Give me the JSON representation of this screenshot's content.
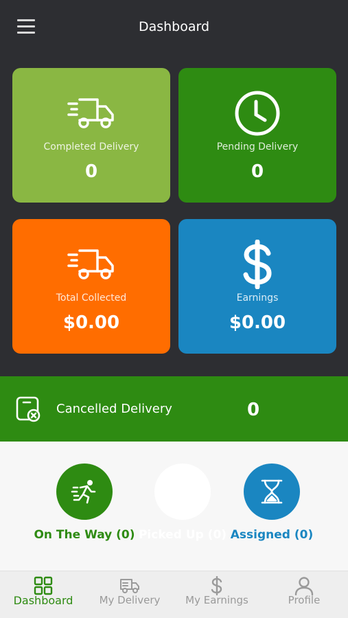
{
  "header": {
    "title": "Dashboard",
    "menu_icon": "hamburger-menu-icon"
  },
  "cards": [
    {
      "label": "Completed Delivery",
      "value": "0",
      "color": "#8ab743",
      "icon": "delivery-truck-icon"
    },
    {
      "label": "Pending Delivery",
      "value": "0",
      "color": "#2e8b12",
      "icon": "clock-icon"
    },
    {
      "label": "Total Collected",
      "value": "$0.00",
      "color": "#ff6d00",
      "icon": "delivery-truck-icon"
    },
    {
      "label": "Earnings",
      "value": "$0.00",
      "color": "#1a86c1",
      "icon": "dollar-icon"
    }
  ],
  "cancelled": {
    "label": "Cancelled Delivery",
    "value": "0",
    "color": "#2e8b12",
    "icon": "cancelled-package-icon"
  },
  "status": [
    {
      "label": "On The Way (0)",
      "color": "#2e8b12",
      "icon": "running-icon"
    },
    {
      "label": "Picked Up (0)",
      "color": "#ffffff",
      "icon": ""
    },
    {
      "label": "Assigned (0)",
      "color": "#1a86c1",
      "icon": "hourglass-icon"
    }
  ],
  "nav": [
    {
      "label": "Dashboard",
      "icon": "grid-icon",
      "active": true
    },
    {
      "label": "My Delivery",
      "icon": "delivery-truck-icon",
      "active": false
    },
    {
      "label": "My Earnings",
      "icon": "dollar-icon",
      "active": false
    },
    {
      "label": "Profile",
      "icon": "person-icon",
      "active": false
    }
  ],
  "colors": {
    "header_bg": "#2d2e32",
    "accent_green": "#2e8b12",
    "accent_blue": "#1a86c1"
  }
}
